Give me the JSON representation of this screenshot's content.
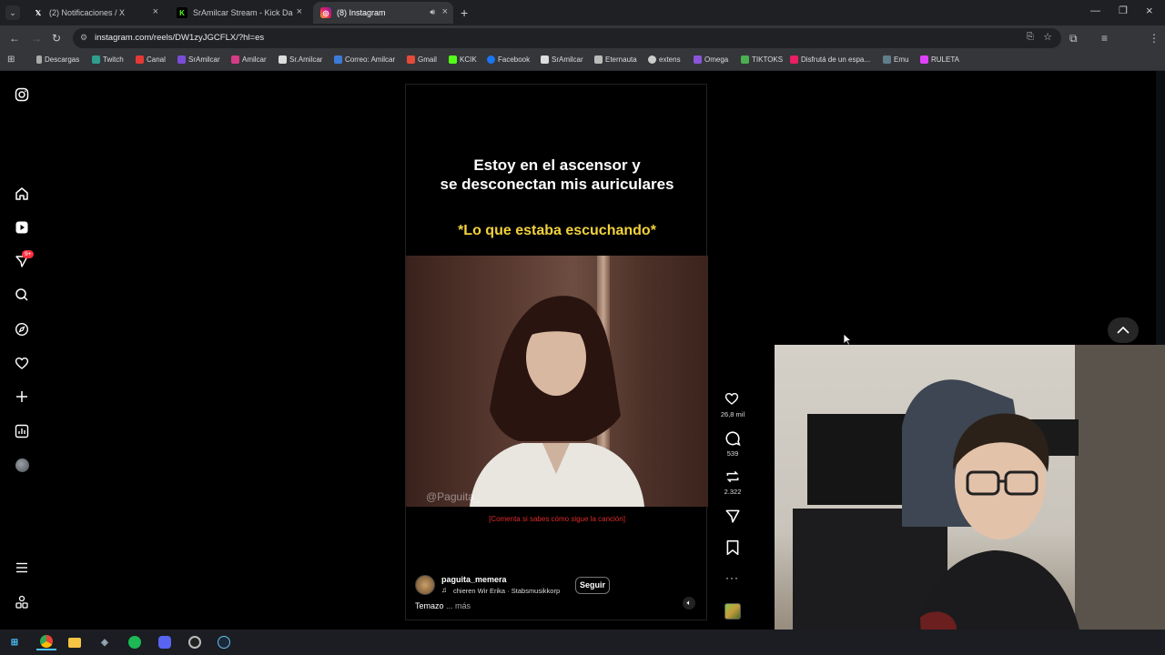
{
  "tabs": [
    {
      "title": "(2) Notificaciones / X",
      "icon": "x-icon"
    },
    {
      "title": "SrAmilcar Stream - Kick Dashbo",
      "icon": "kick-icon"
    },
    {
      "title": "(8) Instagram",
      "icon": "instagram-icon"
    }
  ],
  "omnibox": {
    "url": "instagram.com/reels/DW1zyJGCFLX/?hl=es"
  },
  "bookmarks": [
    {
      "label": "Descargas",
      "color": "#aaaaaa"
    },
    {
      "label": "Twitch",
      "color": "#2f9e8c"
    },
    {
      "label": "Canal",
      "color": "#e53935"
    },
    {
      "label": "SrAmilcar",
      "color": "#7a4dd8"
    },
    {
      "label": "Amilcar",
      "color": "#d63c86"
    },
    {
      "label": "Sr.Amilcar",
      "color": "#dddddd"
    },
    {
      "label": "Correo: Amilcar",
      "color": "#3d7bd9"
    },
    {
      "label": "Gmail",
      "color": "#e44b3b"
    },
    {
      "label": "KCIK",
      "color": "#53fc18"
    },
    {
      "label": "Facebook",
      "color": "#1877f2"
    },
    {
      "label": "SrAmilcar",
      "color": "#dddddd"
    },
    {
      "label": "Eternauta",
      "color": "#bbbbbb"
    },
    {
      "label": "extens",
      "color": "#cccccc"
    },
    {
      "label": "Omega",
      "color": "#8b55d9"
    },
    {
      "label": "TIKTOKS",
      "color": "#4caf50"
    },
    {
      "label": "Disfrutá de un espa...",
      "color": "#e91e63"
    },
    {
      "label": "Emu",
      "color": "#607d8b"
    },
    {
      "label": "RULETA",
      "color": "#e040fb"
    }
  ],
  "sidebar": {
    "notification_badge": "9+"
  },
  "reel": {
    "title_text": "Estoy en el ascensor y\nse desconectan mis auriculares",
    "highlight_text": "*Lo que estaba escuchando*",
    "watermark": "@Paguita_",
    "red_note": "[Comenta si sabes cómo sigue la canción]",
    "username": "paguita_memera",
    "audio": "chieren Wir Erika · Stabsmusikkorp",
    "follow_label": "Seguir",
    "caption": "Temazo",
    "more_label": "... más"
  },
  "actions": {
    "likes": "26,8 mil",
    "comments": "539",
    "reposts": "2.322"
  },
  "colors": {
    "highlight": "#f2d23c",
    "red_note": "#e02a2a",
    "badge": "#ff3040"
  }
}
